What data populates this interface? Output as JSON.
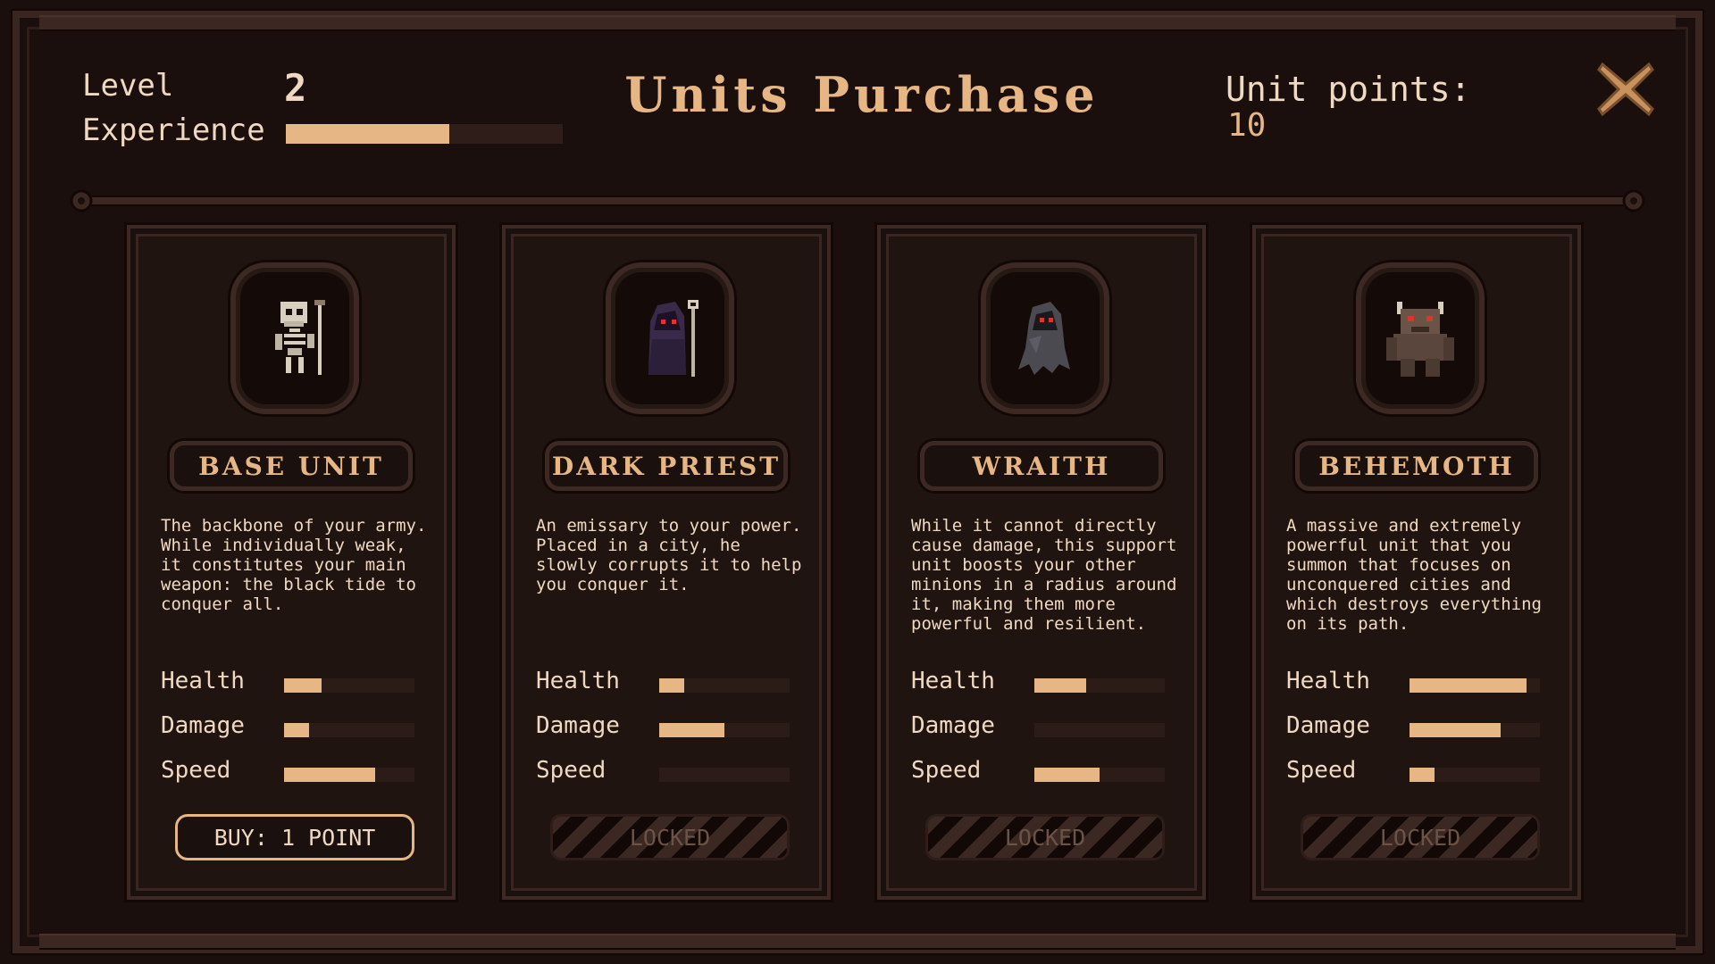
{
  "header": {
    "level_label": "Level",
    "level_value": "2",
    "experience_label": "Experience",
    "experience_progress": 0.59,
    "title": "Units Purchase",
    "points_label": "Unit points:",
    "points_value": "10"
  },
  "colors": {
    "accent": "#e6b784",
    "text": "#efd9c2",
    "background": "#1a0f0c",
    "panel": "#1f1410",
    "border": "#3d2923"
  },
  "icons": [
    "close-icon",
    "skeleton-portrait",
    "dark-priest-portrait",
    "wraith-portrait",
    "behemoth-portrait"
  ],
  "stat_labels": {
    "health": "Health",
    "damage": "Damage",
    "speed": "Speed"
  },
  "units": [
    {
      "name": "BASE UNIT",
      "description": "The backbone of your army. While individually weak, it constitutes your main weapon: the black tide to conquer all.",
      "stats": {
        "health": 0.29,
        "damage": 0.19,
        "speed": 0.7
      },
      "button_label": "BUY: 1 POINT",
      "locked": false
    },
    {
      "name": "DARK PRIEST",
      "description": "An emissary to your power. Placed in a city, he slowly corrupts it to help you conquer it.",
      "stats": {
        "health": 0.19,
        "damage": 0.5,
        "speed": 0.0
      },
      "button_label": "LOCKED",
      "locked": true
    },
    {
      "name": "WRAITH",
      "description": "While it cannot directly cause damage, this support unit boosts your other minions in a radius around it, making them more powerful and resilient.",
      "stats": {
        "health": 0.4,
        "damage": 0.0,
        "speed": 0.5
      },
      "button_label": "LOCKED",
      "locked": true
    },
    {
      "name": "BEHEMOTH",
      "description": "A massive and extremely powerful unit that you summon that focuses on unconquered cities and which destroys everything on its path.",
      "stats": {
        "health": 0.9,
        "damage": 0.7,
        "speed": 0.19
      },
      "button_label": "LOCKED",
      "locked": true
    }
  ]
}
